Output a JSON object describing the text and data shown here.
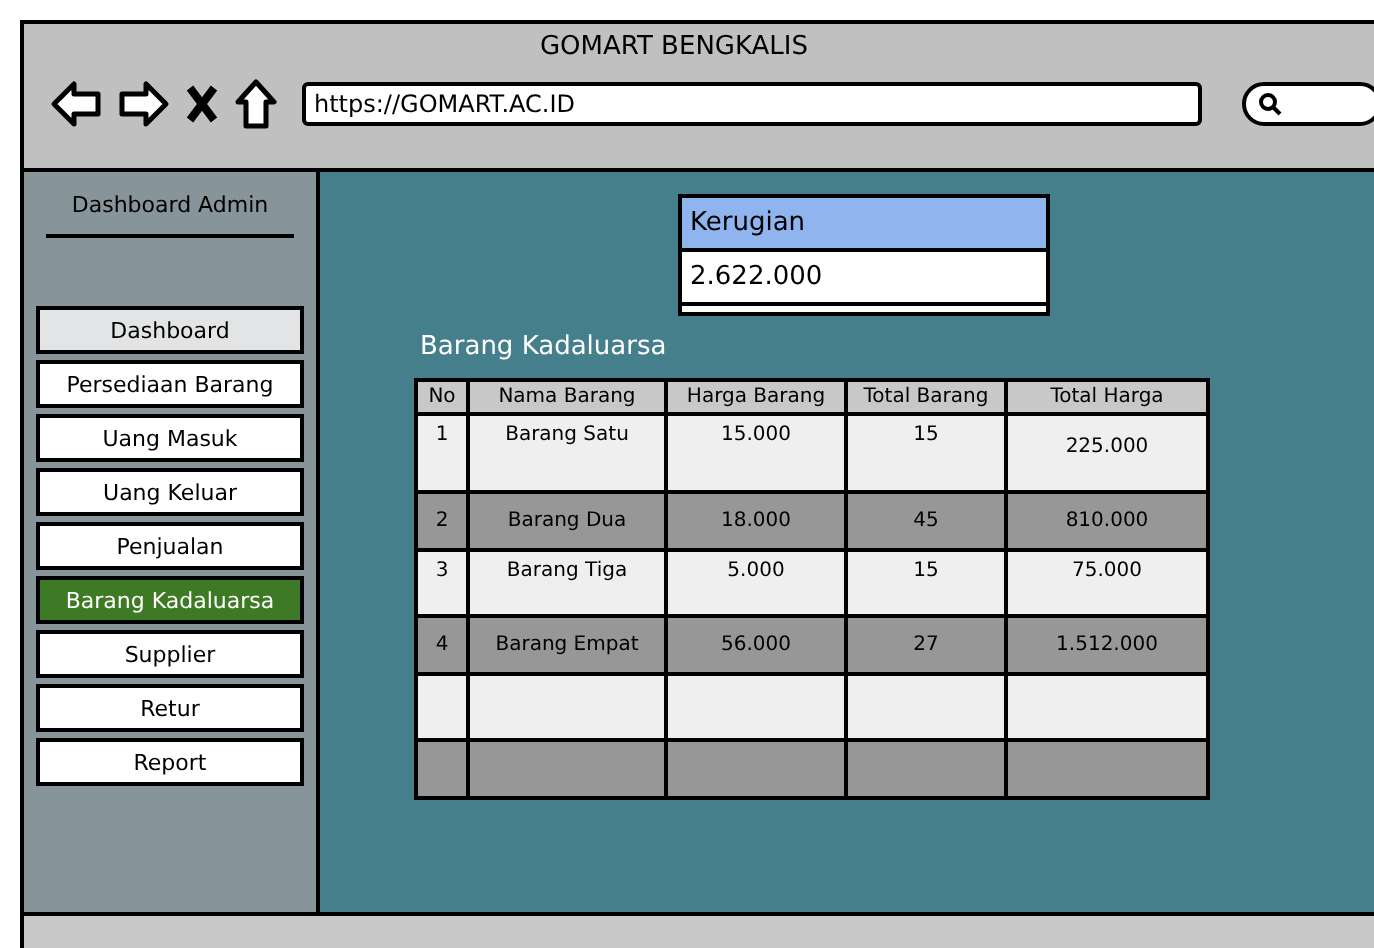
{
  "window": {
    "title": "GOMART BENGKALIS"
  },
  "address_bar": {
    "value": "https://GOMART.AC.ID"
  },
  "sidebar": {
    "title": "Dashboard Admin",
    "items": [
      {
        "label": "Dashboard",
        "selected": false,
        "shaded": true
      },
      {
        "label": "Persediaan Barang",
        "selected": false,
        "shaded": false
      },
      {
        "label": "Uang Masuk",
        "selected": false,
        "shaded": false
      },
      {
        "label": "Uang Keluar",
        "selected": false,
        "shaded": false
      },
      {
        "label": "Penjualan",
        "selected": false,
        "shaded": false
      },
      {
        "label": "Barang Kadaluarsa",
        "selected": true,
        "shaded": false
      },
      {
        "label": "Supplier",
        "selected": false,
        "shaded": false
      },
      {
        "label": "Retur",
        "selected": false,
        "shaded": false
      },
      {
        "label": "Report",
        "selected": false,
        "shaded": false
      }
    ]
  },
  "summary": {
    "label": "Kerugian",
    "value": "2.622.000"
  },
  "table": {
    "title": "Barang Kadaluarsa",
    "columns": [
      "No",
      "Nama Barang",
      "Harga Barang",
      "Total Barang",
      "Total Harga"
    ],
    "rows": [
      [
        "1",
        "Barang Satu",
        "15.000",
        "15",
        "225.000"
      ],
      [
        "2",
        "Barang Dua",
        "18.000",
        "45",
        "810.000"
      ],
      [
        "3",
        "Barang Tiga",
        "5.000",
        "15",
        "75.000"
      ],
      [
        "4",
        "Barang Empat",
        "56.000",
        "27",
        "1.512.000"
      ]
    ]
  }
}
